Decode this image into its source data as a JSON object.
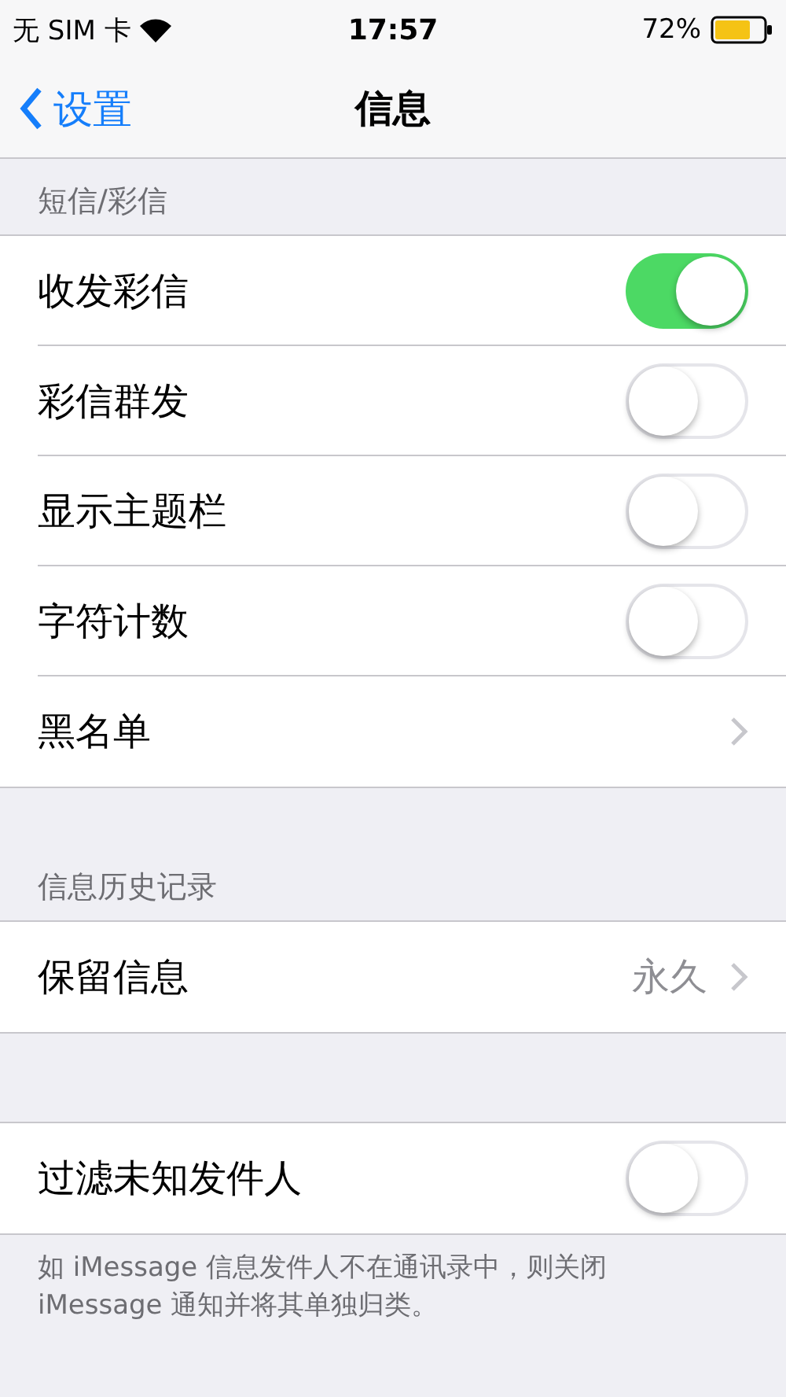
{
  "status_bar": {
    "carrier": "无 SIM 卡",
    "time": "17:57",
    "battery": "72%"
  },
  "nav": {
    "back": "设置",
    "title": "信息"
  },
  "sections": [
    {
      "header": "短信/彩信",
      "rows": [
        {
          "kind": "toggle",
          "label": "收发彩信",
          "on": true
        },
        {
          "kind": "toggle",
          "label": "彩信群发",
          "on": false
        },
        {
          "kind": "toggle",
          "label": "显示主题栏",
          "on": false
        },
        {
          "kind": "toggle",
          "label": "字符计数",
          "on": false
        },
        {
          "kind": "link",
          "label": "黑名单"
        }
      ]
    },
    {
      "header": "信息历史记录",
      "rows": [
        {
          "kind": "link",
          "label": "保留信息",
          "value": "永久"
        }
      ]
    },
    {
      "rows": [
        {
          "kind": "toggle",
          "label": "过滤未知发件人",
          "on": false
        }
      ],
      "footer": "如 iMessage 信息发件人不在通讯录中，则关闭 iMessage 通知并将其单独归类。"
    }
  ]
}
